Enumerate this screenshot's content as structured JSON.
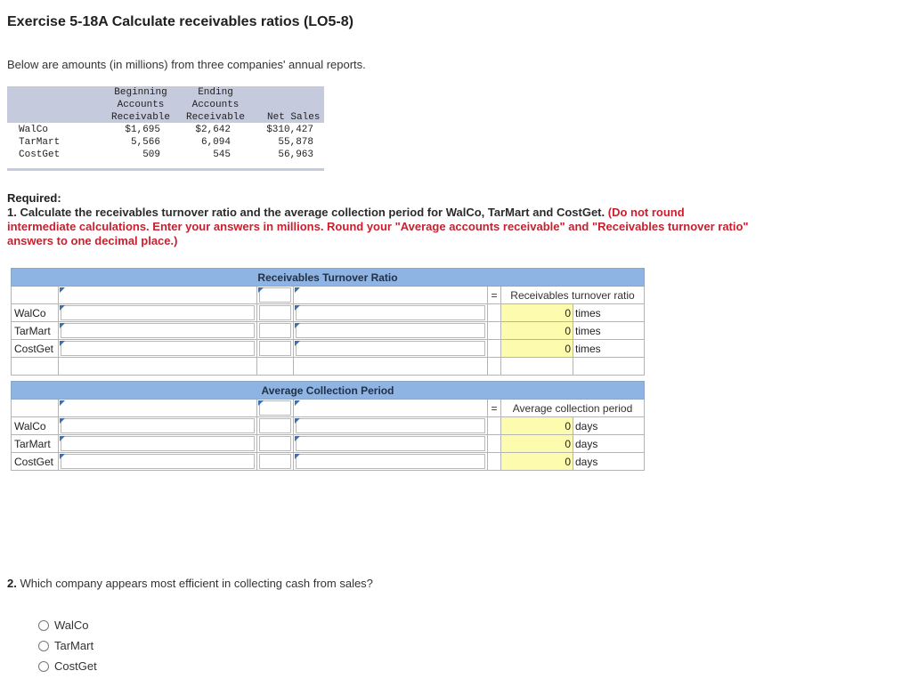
{
  "title": "Exercise 5-18A Calculate receivables ratios (LO5-8)",
  "intro": "Below are amounts (in millions) from three companies' annual reports.",
  "given_table": {
    "headers": {
      "beginning": [
        "Beginning",
        "Accounts",
        "Receivable"
      ],
      "ending": [
        "Ending",
        "Accounts",
        "Receivable"
      ],
      "sales": "Net Sales"
    },
    "rows": [
      {
        "company": "WalCo",
        "beginning": "$1,695",
        "ending": "$2,642",
        "sales": "$310,427"
      },
      {
        "company": "TarMart",
        "beginning": "5,566",
        "ending": "6,094",
        "sales": "55,878"
      },
      {
        "company": "CostGet",
        "beginning": "509",
        "ending": "545",
        "sales": "56,963"
      }
    ]
  },
  "required": {
    "heading": "Required:",
    "text": "1. Calculate the receivables turnover ratio and the average collection period for WalCo, TarMart and CostGet.",
    "instruction": "(Do not round intermediate calculations. Enter your answers in millions. Round your \"Average accounts receivable\" and \"Receivables turnover ratio\" answers to one decimal place.)"
  },
  "turnover": {
    "header": "Receivables Turnover Ratio",
    "equals": "=",
    "result_label": "Receivables turnover ratio",
    "rows": [
      {
        "company": "WalCo",
        "value": "0",
        "unit": "times"
      },
      {
        "company": "TarMart",
        "value": "0",
        "unit": "times"
      },
      {
        "company": "CostGet",
        "value": "0",
        "unit": "times"
      }
    ]
  },
  "collection": {
    "header": "Average Collection Period",
    "equals": "=",
    "result_label": "Average collection period",
    "rows": [
      {
        "company": "WalCo",
        "value": "0",
        "unit": "days"
      },
      {
        "company": "TarMart",
        "value": "0",
        "unit": "days"
      },
      {
        "company": "CostGet",
        "value": "0",
        "unit": "days"
      }
    ]
  },
  "question2": {
    "number": "2.",
    "text": "Which company appears most efficient in collecting cash from sales?",
    "options": [
      "WalCo",
      "TarMart",
      "CostGet"
    ]
  },
  "colors": {
    "header_blue": "#8db4e2",
    "answer_yellow": "#fdfbae",
    "instruction_red": "#c8202f"
  }
}
